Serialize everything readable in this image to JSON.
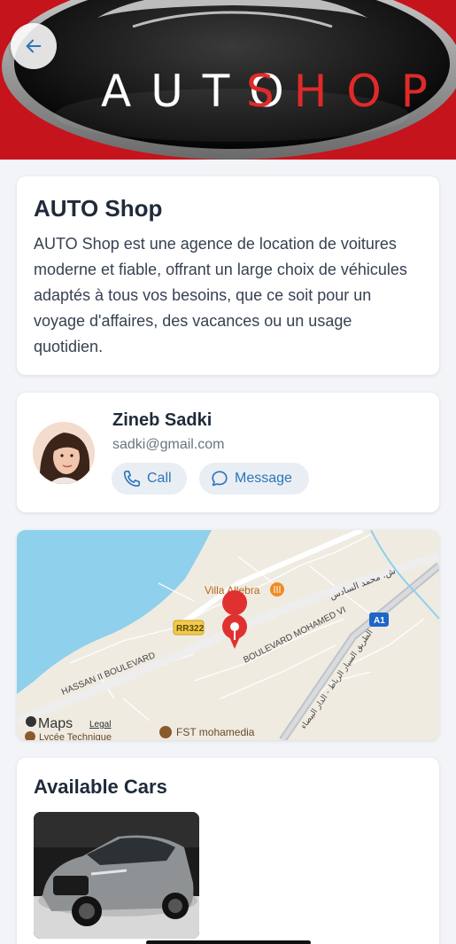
{
  "hero": {
    "logo_text_white": "AUTO",
    "logo_text_red": "SHOP",
    "back_icon": "arrow-left-icon"
  },
  "about": {
    "title": "AUTO Shop",
    "description": "AUTO Shop est une agence de location de voitures moderne et fiable, offrant un large choix de véhicules adaptés à tous vos besoins, que ce soit pour un voyage d'affaires, des vacances ou un usage quotidien."
  },
  "owner": {
    "name": "Zineb Sadki",
    "email": "sadki@gmail.com",
    "call_label": "Call",
    "message_label": "Message"
  },
  "map": {
    "poi_villa": "Villa Allebra",
    "road_rr322": "RR322",
    "road_a1": "A1",
    "hassan_blvd": "HASSAN II BOULEVARD",
    "mohamed_blvd": "BOULEVARD MOHAMED VI",
    "arabic_top": "ش. محمد السادس",
    "arabic_side": "الطريق السيار الرباط - الدار البيضاء",
    "fst": "FST mohamedia",
    "lycee": "Lycée Technique",
    "maps_brand": "Maps",
    "legal": "Legal"
  },
  "cars": {
    "title": "Available Cars"
  },
  "colors": {
    "accent": "#2e74b8",
    "brand_red": "#c6141d",
    "pin": "#e03131"
  }
}
